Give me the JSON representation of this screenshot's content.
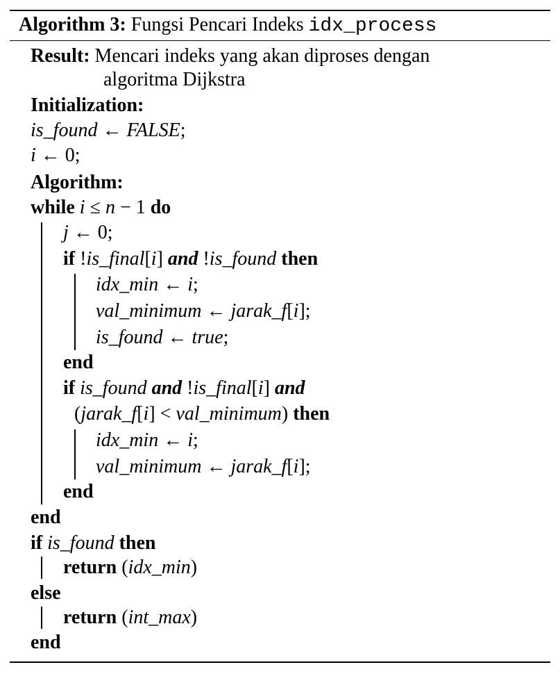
{
  "header": {
    "label": "Algorithm 3:",
    "title": "Fungsi Pencari Indeks",
    "func_name": "idx_process"
  },
  "result": {
    "label": "Result:",
    "line1": "Mencari indeks yang akan diproses dengan",
    "line2": "algoritma Dijkstra"
  },
  "init": {
    "label": "Initialization:",
    "l1": {
      "a": "is_found",
      "arrow": "←",
      "b": "FALSE",
      "end": ";"
    },
    "l2": {
      "a": "i",
      "arrow": "←",
      "b": "0;"
    }
  },
  "algo": {
    "label": "Algorithm:",
    "while": {
      "kw": "while",
      "cond_i": "i",
      "le": "≤",
      "cond_n": "n",
      "minus": "−",
      "one": "1",
      "do": "do"
    },
    "j_line": {
      "a": "j",
      "arrow": "←",
      "b": "0;"
    },
    "if1": {
      "kw": "if",
      "not1": "!",
      "v1": "is_final",
      "br1": "[",
      "idx1": "i",
      "br2": "]",
      "and": "and",
      "not2": "!",
      "v2": "is_found",
      "then": "then"
    },
    "if1_body": [
      {
        "a": "idx_min",
        "arrow": "←",
        "b": "i",
        "end": ";"
      },
      {
        "a": "val_minimum",
        "arrow": "←",
        "b": "jarak_f",
        "br1": "[",
        "idx": "i",
        "br2": "]",
        "end": ";"
      },
      {
        "a": "is_found",
        "arrow": "←",
        "b": "true",
        "end": ";"
      }
    ],
    "end_inner1": "end",
    "if2": {
      "kw": "if",
      "v1": "is_found",
      "and1": "and",
      "not": "!",
      "v2": "is_final",
      "br1": "[",
      "idx": "i",
      "br2": "]",
      "and2": "and"
    },
    "if2_cont": {
      "lp": "(",
      "v1": "jarak_f",
      "br1": "[",
      "idx": "i",
      "br2": "]",
      "lt": "<",
      "v2": "val_minimum",
      "rp": ")",
      "then": "then"
    },
    "if2_body": [
      {
        "a": "idx_min",
        "arrow": "←",
        "b": "i",
        "end": ";"
      },
      {
        "a": "val_minimum",
        "arrow": "←",
        "b": "jarak_f",
        "br1": "[",
        "idx": "i",
        "br2": "]",
        "end": ";"
      }
    ],
    "end_inner2": "end",
    "end_while": "end",
    "if3": {
      "kw": "if",
      "v": "is_found",
      "then": "then"
    },
    "return1": {
      "kw": "return",
      "lp": "(",
      "v": "idx_min",
      "rp": ")"
    },
    "else": "else",
    "return2": {
      "kw": "return",
      "lp": "(",
      "v": "int_max",
      "rp": ")"
    },
    "end_final": "end"
  }
}
